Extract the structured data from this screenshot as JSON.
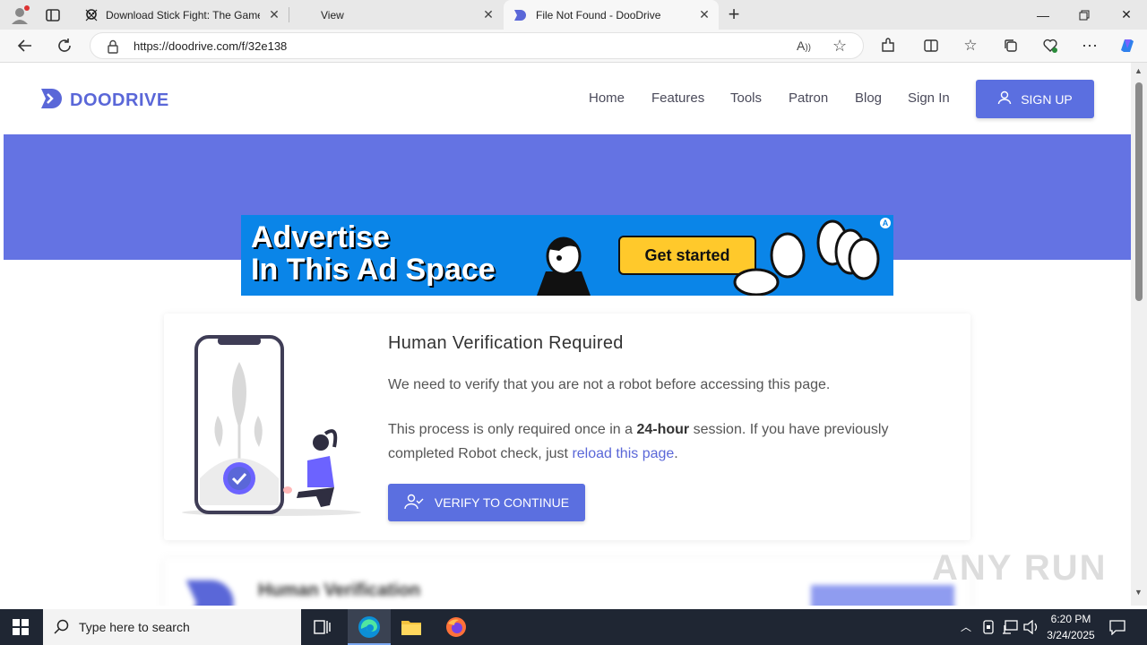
{
  "browser": {
    "tabs": [
      {
        "title": "Download Stick Fight: The Game",
        "active": false
      },
      {
        "title": "View",
        "active": false
      },
      {
        "title": "File Not Found - DooDrive",
        "active": true
      }
    ],
    "new_tab": "+",
    "url": "https://doodrive.com/f/32e138"
  },
  "site": {
    "logo_text": "DOODRIVE",
    "nav": [
      "Home",
      "Features",
      "Tools",
      "Patron",
      "Blog",
      "Sign In"
    ],
    "signup_label": "SIGN UP",
    "brand_color": "#5b6fe0"
  },
  "ad": {
    "line1": "Advertise",
    "line2": "In This Ad Space",
    "button": "Get started"
  },
  "card": {
    "title": "Human Verification Required",
    "p1": "We need to verify that you are not a robot before accessing this page.",
    "p2_a": "This process is only required once in a ",
    "p2_bold": "24-hour",
    "p2_b": " session. If you have previously completed Robot check, just ",
    "p2_link": "reload this page",
    "p2_c": ".",
    "button": "VERIFY TO CONTINUE"
  },
  "card2": {
    "title": "Human Verification"
  },
  "watermark": "ANY RUN",
  "taskbar": {
    "search_placeholder": "Type here to search",
    "time": "6:20 PM",
    "date": "3/24/2025"
  }
}
